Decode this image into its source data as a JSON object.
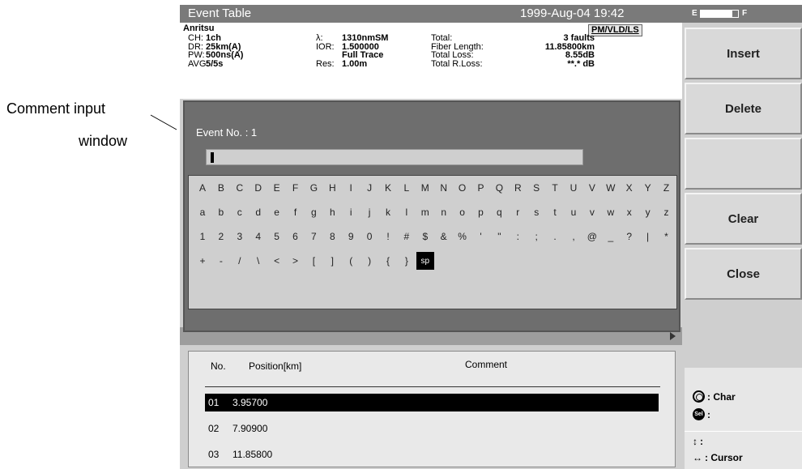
{
  "callout": {
    "line1": "Comment input",
    "line2": "window"
  },
  "title_bar": {
    "title": "Event Table",
    "datetime": "1999-Aug-04 19:42"
  },
  "battery": {
    "empty_label": "E",
    "full_label": "F",
    "level": 0.85
  },
  "info": {
    "vendor": "Anritsu",
    "mode": "PM/VLD/LS",
    "col1": [
      {
        "label": "CH:",
        "value": "1ch"
      },
      {
        "label": "DR:",
        "value": "25km(A)"
      },
      {
        "label": "PW:",
        "value": "500ns(A)"
      },
      {
        "label": "AVG:",
        "value": "5/5s"
      }
    ],
    "col2": [
      {
        "label": "λ:",
        "value": "1310nmSM"
      },
      {
        "label": "IOR:",
        "value": "1.500000"
      },
      {
        "label": "",
        "value": "Full Trace"
      },
      {
        "label": "Res:",
        "value": "1.00m"
      }
    ],
    "col3": [
      {
        "label": "Total:",
        "value": "3 faults"
      },
      {
        "label": "Fiber Length:",
        "value": "11.85800km"
      },
      {
        "label": "Total Loss:",
        "value": "8.55dB"
      },
      {
        "label": "Total R.Loss:",
        "value": "**.* dB"
      }
    ]
  },
  "softkeys": [
    "Insert",
    "Delete",
    "",
    "Clear",
    "Close"
  ],
  "help": {
    "knob": ": Char",
    "sel": ":",
    "updown": ":",
    "leftright": ": Cursor"
  },
  "dialog": {
    "event_label": "Event No. : 1",
    "input_value": "",
    "rows": [
      [
        "A",
        "B",
        "C",
        "D",
        "E",
        "F",
        "G",
        "H",
        "I",
        "J",
        "K",
        "L",
        "M",
        "N",
        "O",
        "P",
        "Q",
        "R",
        "S",
        "T",
        "U",
        "V",
        "W",
        "X",
        "Y",
        "Z"
      ],
      [
        "a",
        "b",
        "c",
        "d",
        "e",
        "f",
        "g",
        "h",
        "i",
        "j",
        "k",
        "l",
        "m",
        "n",
        "o",
        "p",
        "q",
        "r",
        "s",
        "t",
        "u",
        "v",
        "w",
        "x",
        "y",
        "z"
      ],
      [
        "1",
        "2",
        "3",
        "4",
        "5",
        "6",
        "7",
        "8",
        "9",
        "0",
        "!",
        "#",
        "$",
        "&",
        "%",
        "'",
        "\"",
        ":",
        ";",
        ".",
        ",",
        "@",
        "_",
        "?",
        "|",
        "*"
      ],
      [
        "+",
        "-",
        "/",
        "\\",
        "<",
        ">",
        "[",
        "]",
        "(",
        ")",
        "{",
        "}",
        "sp"
      ]
    ],
    "selected_char": "sp"
  },
  "table": {
    "headers": {
      "no": "No.",
      "position": "Position[km]",
      "comment": "Comment"
    },
    "rows": [
      {
        "no": "01",
        "position": "3.95700",
        "comment": "",
        "selected": true
      },
      {
        "no": "02",
        "position": "7.90900",
        "comment": "",
        "selected": false
      },
      {
        "no": "03",
        "position": "11.85800",
        "comment": "",
        "selected": false
      }
    ]
  }
}
